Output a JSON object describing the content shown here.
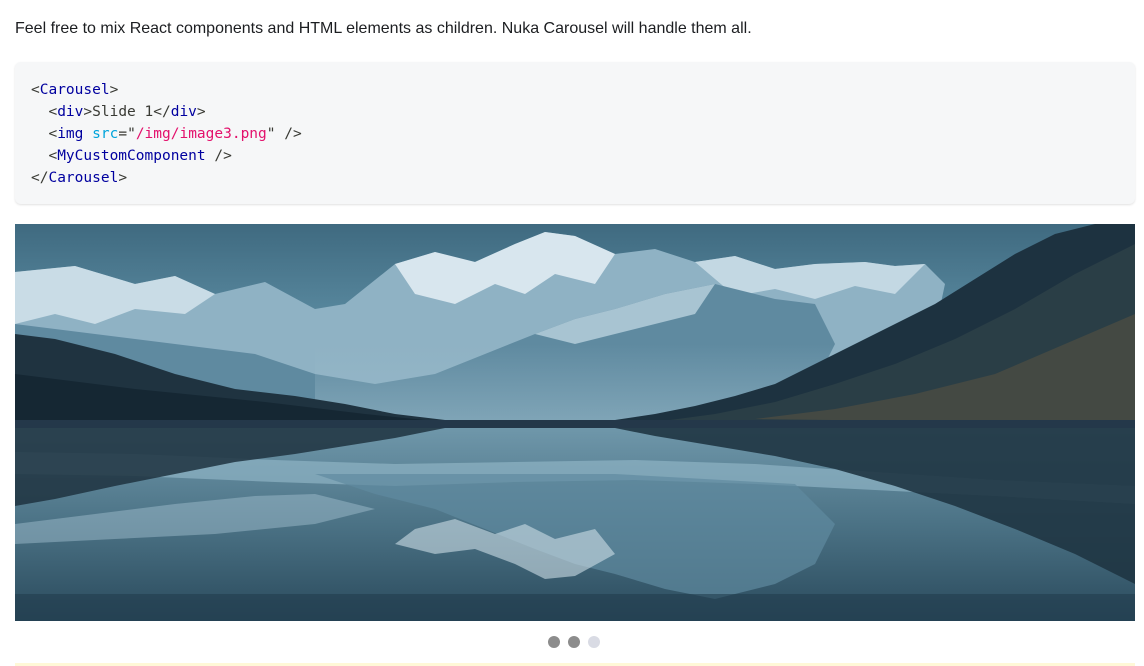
{
  "intro_text": "Feel free to mix React components and HTML elements as children. Nuka Carousel will handle them all.",
  "code": {
    "line1": {
      "open": "<",
      "tag": "Carousel",
      "close": ">"
    },
    "line2": {
      "indent": "  ",
      "open": "<",
      "tag": "div",
      "close": ">",
      "text": "Slide 1",
      "end_open": "</",
      "end_tag": "div",
      "end_close": ">"
    },
    "line3": {
      "indent": "  ",
      "open": "<",
      "tag": "img",
      "space": " ",
      "attr": "src",
      "eq": "=\"",
      "value": "/img/image3.png",
      "end": "\" />"
    },
    "line4": {
      "indent": "  ",
      "open": "<",
      "tag": "MyCustomComponent",
      "end": " />"
    },
    "line5": {
      "open": "</",
      "tag": "Carousel",
      "close": ">"
    }
  },
  "carousel": {
    "image_alt": "Mountain lake reflection",
    "slide_count": 3,
    "active_index": 2
  },
  "colors": {
    "code_tag": "#00009f",
    "code_attr": "#00a4db",
    "code_string": "#e3116c",
    "dot_inactive": "#8c8c8c",
    "dot_active": "#d9dbe4"
  }
}
